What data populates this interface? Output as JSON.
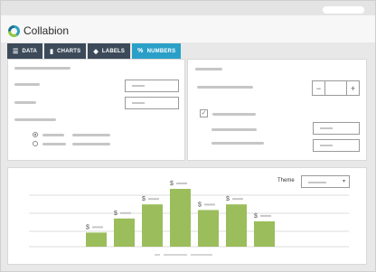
{
  "app": {
    "name": "Collabion"
  },
  "tabs": [
    {
      "label": "DATA",
      "icon": "list-icon",
      "active": false
    },
    {
      "label": "CHARTS",
      "icon": "bar-chart-icon",
      "active": false
    },
    {
      "label": "LABELS",
      "icon": "tag-icon",
      "active": false
    },
    {
      "label": "NUMBERS",
      "icon": "percent-icon",
      "active": true
    }
  ],
  "theme": {
    "label": "Theme"
  },
  "colors": {
    "accent": "#2aa0c8",
    "tab_dark": "#3c4a5a",
    "bar": "#9bbd5b"
  },
  "chart_data": {
    "type": "bar",
    "categories": [
      "",
      "",
      "",
      "",
      "",
      "",
      ""
    ],
    "values": [
      1,
      2,
      3,
      4.1,
      2.6,
      3,
      1.8
    ],
    "value_prefix": "$"
  }
}
